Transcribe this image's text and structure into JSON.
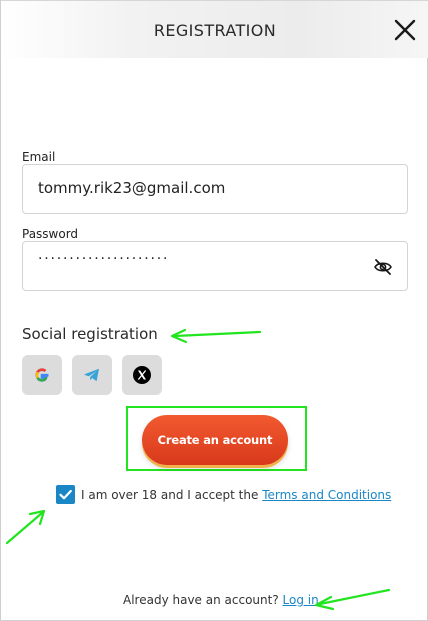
{
  "header": {
    "title": "REGISTRATION",
    "close_icon": "close-icon"
  },
  "form": {
    "email": {
      "label": "Email",
      "value": "tommy.rik23@gmail.com"
    },
    "password": {
      "label": "Password",
      "masked_value": "·····················",
      "toggle_icon": "eye-slash-icon"
    }
  },
  "social": {
    "title": "Social registration",
    "providers": [
      {
        "icon": "google-icon"
      },
      {
        "icon": "telegram-icon"
      },
      {
        "icon": "x-icon"
      }
    ]
  },
  "actions": {
    "create_label": "Create an account",
    "terms_checked": true,
    "terms_text": "I am over 18 and I accept the ",
    "terms_link": "Terms and Conditions"
  },
  "footer": {
    "text": "Already have an account? ",
    "login_link": "Log in"
  },
  "colors": {
    "accent": "#1b86c6",
    "button": "#e0431f",
    "annotation": "#22e51f"
  }
}
